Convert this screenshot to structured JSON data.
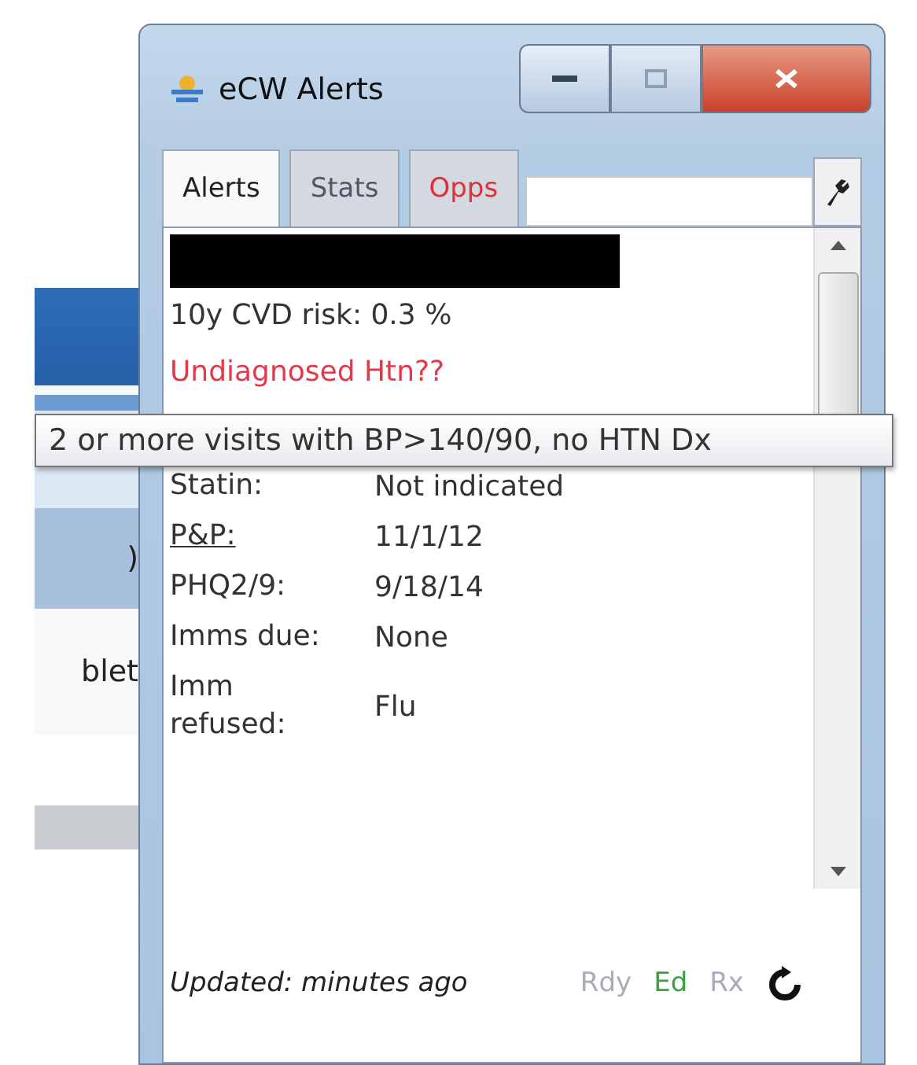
{
  "background": {
    "texts": [
      ")",
      "blet"
    ]
  },
  "window": {
    "title": "eCW Alerts"
  },
  "tabs": [
    {
      "label": "Alerts",
      "selected": true,
      "alert": false
    },
    {
      "label": "Stats",
      "selected": false,
      "alert": false
    },
    {
      "label": "Opps",
      "selected": false,
      "alert": true
    }
  ],
  "alerts": [
    {
      "text": "10y CVD risk: 0.3 %",
      "warning": false
    },
    {
      "text": "Undiagnosed Htn??",
      "warning": true
    }
  ],
  "tooltip": "2 or more visits with BP>140/90, no HTN Dx",
  "rows": [
    {
      "label": "Statin:",
      "value": "Not indicated",
      "link": false
    },
    {
      "label": "P&P:",
      "value": "11/1/12",
      "link": true
    },
    {
      "label": "PHQ2/9:",
      "value": "9/18/14",
      "link": false
    },
    {
      "label": "Imms due:",
      "value": "None",
      "link": false
    },
    {
      "label": "Imm refused:",
      "value": "Flu",
      "link": false
    }
  ],
  "footer": {
    "updated": "Updated: minutes ago",
    "flags": [
      {
        "label": "Rdy",
        "on": false
      },
      {
        "label": "Ed",
        "on": true
      },
      {
        "label": "Rx",
        "on": false
      }
    ]
  }
}
